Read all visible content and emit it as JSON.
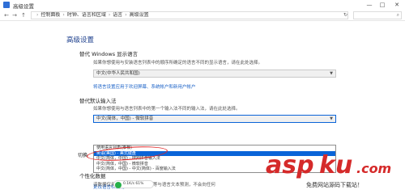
{
  "window": {
    "title": "高级设置",
    "minimize_glyph": "—",
    "maximize_glyph": "□",
    "close_glyph": "✕"
  },
  "address_bar": {
    "back_glyph": "←",
    "forward_glyph": "→",
    "up_glyph": "↑",
    "breadcrumb": [
      "控制面板",
      "时钟、语言和区域",
      "语言",
      "高级设置"
    ],
    "breadcrumb_separator": "›",
    "refresh_glyph": "↻",
    "search_placeholder": "",
    "search_icon": "search-icon"
  },
  "page": {
    "title": "高级设置",
    "sections": [
      {
        "heading": "替代 Windows 显示语言",
        "description": "如果你想使用与安装语言列表中的顺序所确定的语言不同的显示语言，请在此处选择。",
        "select_value": "中文(中华人民共和国)",
        "link": "将语言设置应用于欢迎屏幕、系统帐户和新用户帐户"
      },
      {
        "heading": "替代默认输入法",
        "description": "如果你想使用与语言列表中的第一个输入法不同的输入法，请在此处选择。",
        "select_value": "中文(简体，中国) - 微软拼音",
        "dropdown_options": [
          "使用语言列表(推荐)",
          "英语(美国) - 美式键盘",
          "中文(简体，中国) - 搜狗拼音输入法",
          "中文(简体，中国) - 微软拼音",
          "中文(简体，中国) - 中文(简体) - 百度输入法"
        ],
        "selected_index": 1
      }
    ],
    "left_label": "切换",
    "hotkey_link": "更改语言栏热键",
    "personalization_heading": "个性化数据",
    "personalization_text": "该数据仅用于 IME 的语言表达等与语言文本预测，不会向任何",
    "checkbox_label": ""
  },
  "speed_widget": {
    "line1": "0.1K/s",
    "line2": "0.1K/s",
    "percent": "61%"
  },
  "watermark": {
    "logo_text": "aspku.com",
    "sub_text": "免费网站源码下载站！"
  },
  "colors": {
    "accent": "#1c3f8c",
    "link": "#1e64c8",
    "selection": "#0a64d8",
    "annotation": "#e02020",
    "watermark_red": "#d52a2a"
  }
}
